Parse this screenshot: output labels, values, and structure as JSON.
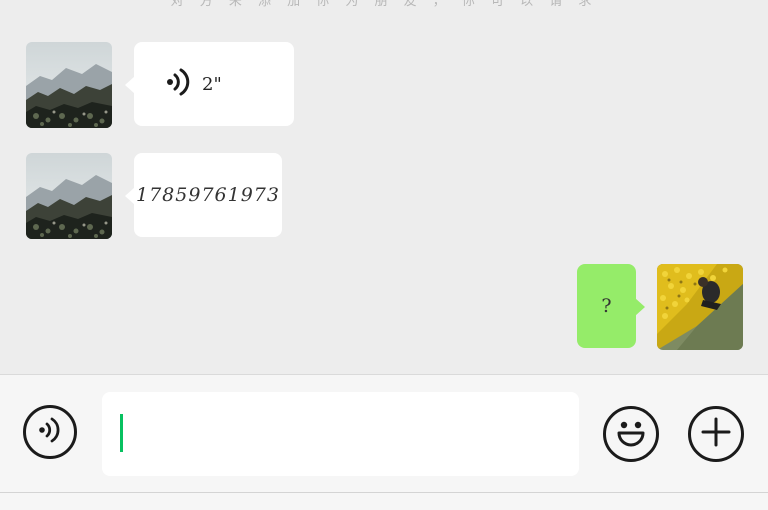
{
  "header": {
    "notice_text": "对 方 未 添 加 你 为 朋 友 ， 你 可 以 请 求"
  },
  "messages": [
    {
      "direction": "incoming",
      "type": "voice",
      "duration": "2\""
    },
    {
      "direction": "incoming",
      "type": "text",
      "text": "17859761973"
    },
    {
      "direction": "outgoing",
      "type": "text",
      "text": "?"
    }
  ],
  "input_bar": {
    "voice_toggle_icon": "voice-input-icon",
    "text_value": "",
    "emoji_icon": "emoji-icon",
    "more_icon": "plus-icon"
  },
  "colors": {
    "background": "#ededed",
    "incoming_bubble": "#ffffff",
    "outgoing_bubble": "#95ec69",
    "caret": "#07c160"
  }
}
